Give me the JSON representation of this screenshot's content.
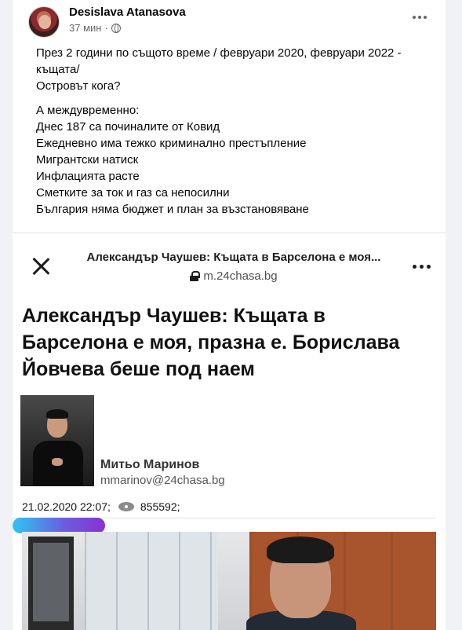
{
  "post": {
    "author": "Desislava Atanasova",
    "time": "37 мин",
    "separator": "·",
    "paragraph1": [
      "През 2 години по същото време / февруари 2020, февруари 2022 -",
      "къщата/",
      "Островът кога?"
    ],
    "paragraph2": [
      "А междувременно:",
      "Днес 187 са починалите от Ковид",
      "Ежедневно има тежко криминално престъпление",
      "Мигрантски натиск",
      "Инфлацията расте",
      "Сметките за ток и газ са непосилни",
      "България няма бюджет и план за възстановяване"
    ]
  },
  "shared": {
    "title": "Александър Чаушев: Къщата в Барселона е моя...",
    "url": "m.24chasa.bg"
  },
  "article": {
    "headline": "Александър Чаушев: Къщата в Барселона е моя, празна е. Борислава Йовчева беше под наем",
    "writer_name": "Митьо Маринов",
    "writer_email": "mmarinov@24chasa.bg",
    "date": "21.02.2020 22:07;",
    "views": "855592;"
  },
  "colors": {
    "page_bg": "#f0f2f5",
    "card_bg": "#ffffff",
    "text": "#050505",
    "secondary": "#65676b",
    "progress_start": "#2ec5f0",
    "progress_end": "#8b2fd6"
  },
  "icons": {
    "globe": "globe-icon",
    "more": "more-icon",
    "close": "close-icon",
    "lock": "lock-icon",
    "eye": "eye-icon"
  }
}
